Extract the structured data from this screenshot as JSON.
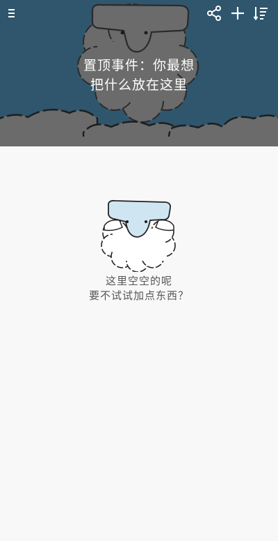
{
  "header": {
    "menu_icon": "menu-icon",
    "share_icon": "share-icon",
    "add_icon": "plus-icon",
    "sort_icon": "sort-list-icon",
    "pinned_line1": "置顶事件：你最想",
    "pinned_line2": "把什么放在这里",
    "colors": {
      "background": "#2f566d",
      "clouds": "#6b6b6b"
    }
  },
  "empty_state": {
    "line1": "这里空空的呢",
    "line2": "要不试试加点东西？",
    "colors": {
      "sheep_face": "#cfe5f2",
      "text": "#555555"
    }
  }
}
